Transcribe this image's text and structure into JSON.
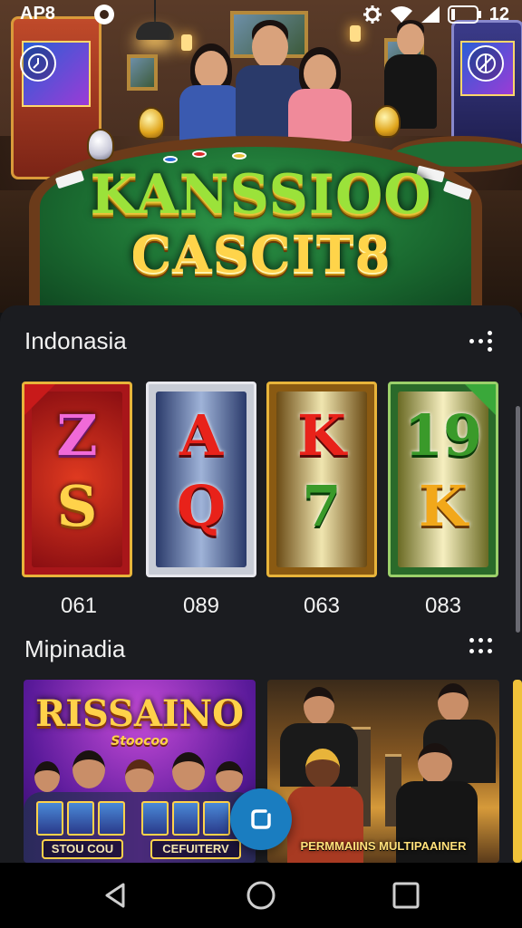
{
  "status_bar": {
    "carrier": "AP8",
    "battery_text": "12",
    "icons": [
      "app-notification-icon",
      "settings-gear-icon",
      "wifi-icon",
      "signal-icon",
      "battery-icon"
    ]
  },
  "hero": {
    "logo_line1": "KANSSIOO",
    "logo_line2": "CASCIT8",
    "left_button_icon": "clock-icon",
    "right_button_icon": "radar-icon"
  },
  "section1": {
    "title": "Indonasia",
    "more_icon": "more-dots-icon",
    "games": [
      {
        "top": "Z",
        "bottom": "S",
        "label": "061"
      },
      {
        "top": "A",
        "bottom": "Q",
        "label": "089"
      },
      {
        "top": "K",
        "bottom": "7",
        "label": "063"
      },
      {
        "top": "19",
        "bottom": "K",
        "label": "083"
      }
    ]
  },
  "section2": {
    "title": "Mipinadia",
    "more_icon": "more-dots-icon",
    "promos": [
      {
        "title": "RISSAINO",
        "subtitle": "Stoocoo",
        "buttons": [
          "STOU COU",
          "CEFUITERV"
        ]
      },
      {
        "caption": "PERMMAIINS MULTIPAAINER"
      }
    ]
  },
  "fab": {
    "icon": "square-shortcut-icon"
  },
  "nav_bar": {
    "icons": [
      "back-triangle-icon",
      "home-circle-icon",
      "recents-square-icon"
    ]
  },
  "colors": {
    "panel_bg": "#1b1c20",
    "fab_blue": "#1a7dc0",
    "table_green": "#1a6a30",
    "gold": "#ffd24a"
  }
}
